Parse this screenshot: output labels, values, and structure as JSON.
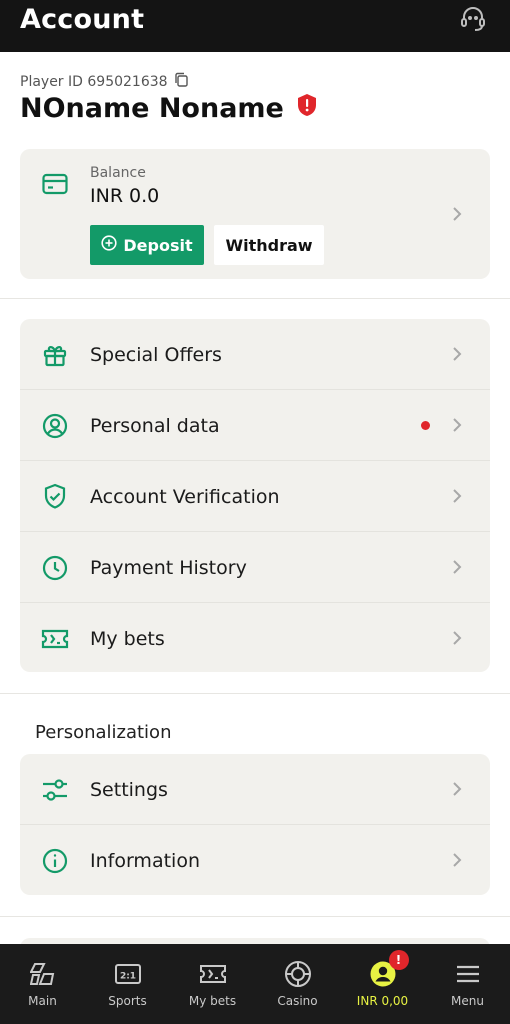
{
  "header": {
    "title": "Account",
    "support_icon": "headset-icon"
  },
  "player": {
    "id_label": "Player ID 695021638",
    "name": "NOname Noname"
  },
  "balance": {
    "label": "Balance",
    "value": "INR 0.0",
    "deposit_label": "Deposit",
    "withdraw_label": "Withdraw"
  },
  "menu": {
    "items": [
      {
        "label": "Special Offers",
        "icon": "gift-icon"
      },
      {
        "label": "Personal data",
        "icon": "user-circle-icon",
        "notification": true
      },
      {
        "label": "Account Verification",
        "icon": "shield-check-icon"
      },
      {
        "label": "Payment History",
        "icon": "clock-icon"
      },
      {
        "label": "My bets",
        "icon": "ticket-icon"
      }
    ]
  },
  "personalization": {
    "title": "Personalization",
    "items": [
      {
        "label": "Settings",
        "icon": "sliders-icon"
      },
      {
        "label": "Information",
        "icon": "info-icon"
      }
    ]
  },
  "bottom_nav": {
    "items": [
      {
        "label": "Main",
        "icon": "main-icon"
      },
      {
        "label": "Sports",
        "icon": "scoreboard-icon"
      },
      {
        "label": "My bets",
        "icon": "ticket-icon"
      },
      {
        "label": "Casino",
        "icon": "casino-chip-icon"
      },
      {
        "label": "INR 0,00",
        "icon": "account-icon",
        "active": true,
        "badge": "!"
      },
      {
        "label": "Menu",
        "icon": "hamburger-icon"
      }
    ]
  },
  "colors": {
    "accent": "#139a68",
    "active_nav": "#e7f243",
    "alert": "#e0262b",
    "header_bg": "#141414"
  }
}
